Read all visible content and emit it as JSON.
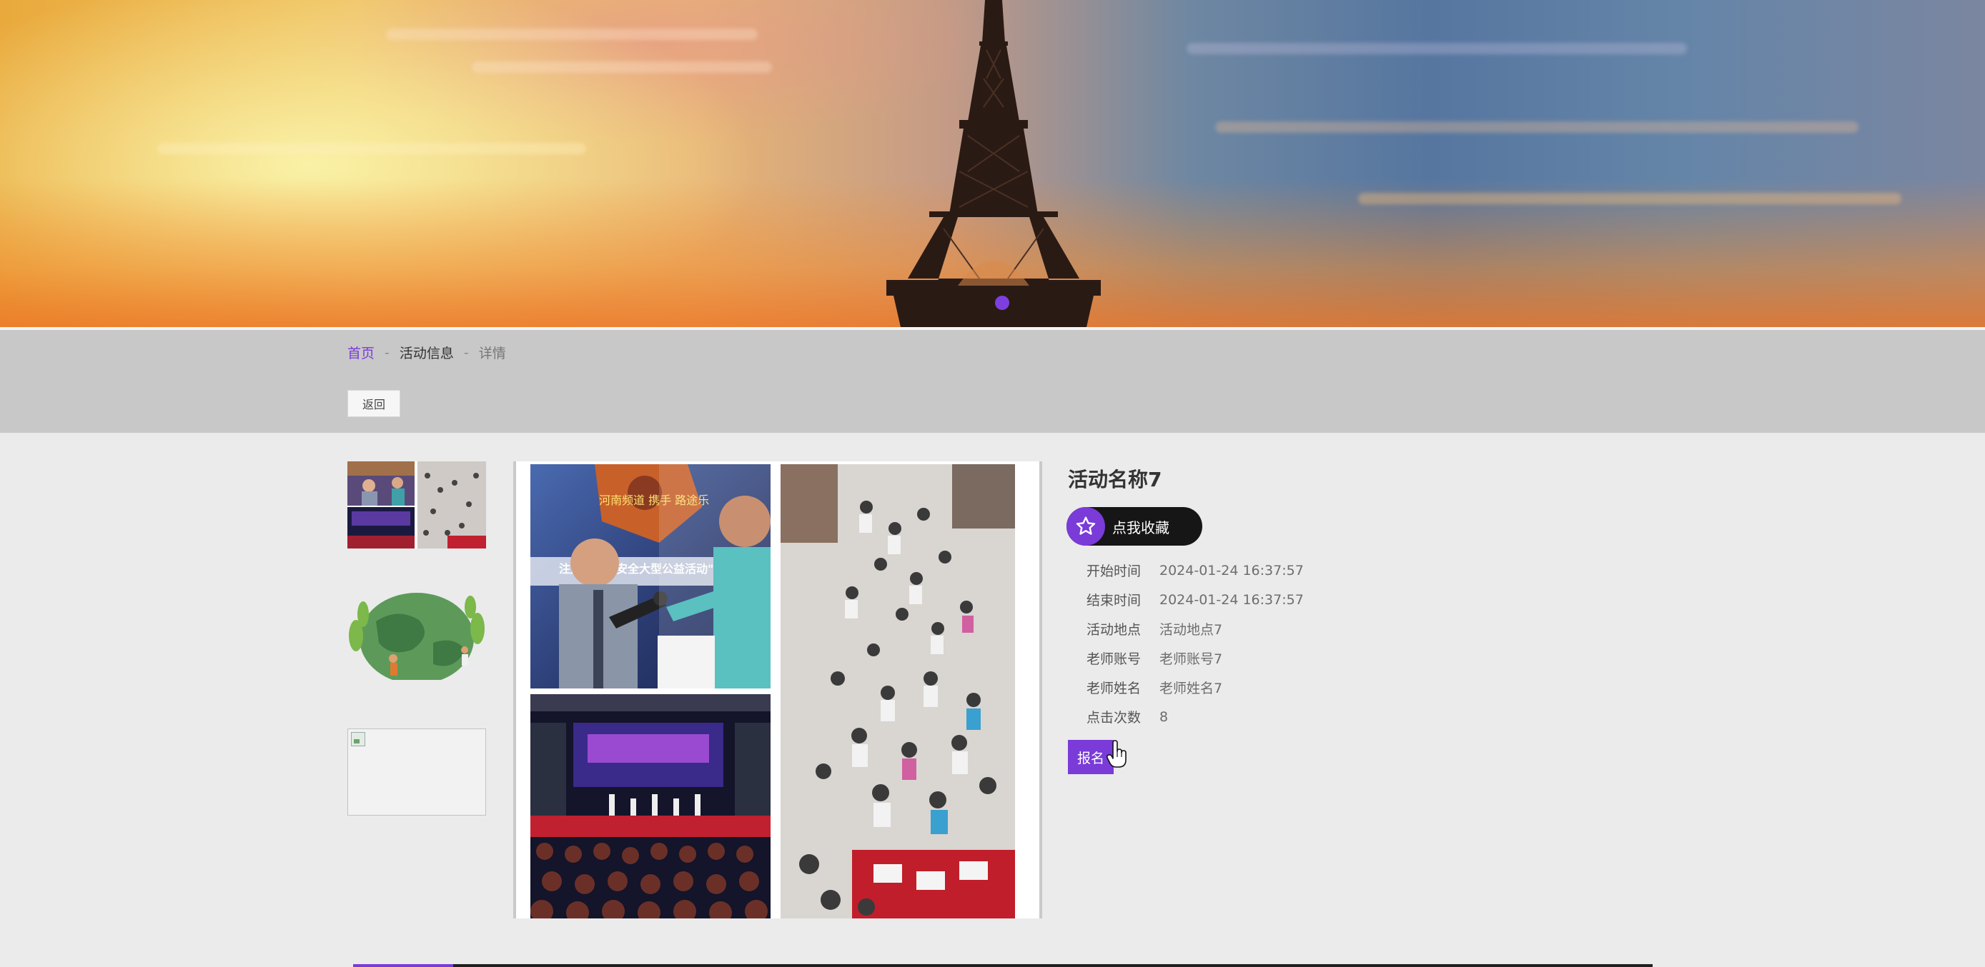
{
  "breadcrumb": {
    "home": "首页",
    "separator": "-",
    "section": "活动信息",
    "current": "详情"
  },
  "back_label": "返回",
  "thumbnail_photos": [
    {
      "index": 1
    },
    {
      "index": 2
    },
    {
      "index": 3,
      "broken": true
    }
  ],
  "main_photo": {
    "top_left_text_1": "河南频道  携手 路途乐",
    "top_left_text_2": "注儿童乘车安全大型公益活动\""
  },
  "activity": {
    "title": "活动名称7",
    "favorite_label": "点我收藏",
    "fields": [
      {
        "label": "开始时间",
        "value": "2024-01-24 16:37:57"
      },
      {
        "label": "结束时间",
        "value": "2024-01-24 16:37:57"
      },
      {
        "label": "活动地点",
        "value": "活动地点7"
      },
      {
        "label": "老师账号",
        "value": "老师账号7"
      },
      {
        "label": "老师姓名",
        "value": "老师姓名7"
      },
      {
        "label": "点击次数",
        "value": "8"
      }
    ],
    "signup_label": "报名"
  },
  "colors": {
    "accent": "#7a3bd8",
    "favorite_bg": "#161616",
    "strip_bg": "#c8c8c8",
    "page_bg": "#ebebeb"
  }
}
